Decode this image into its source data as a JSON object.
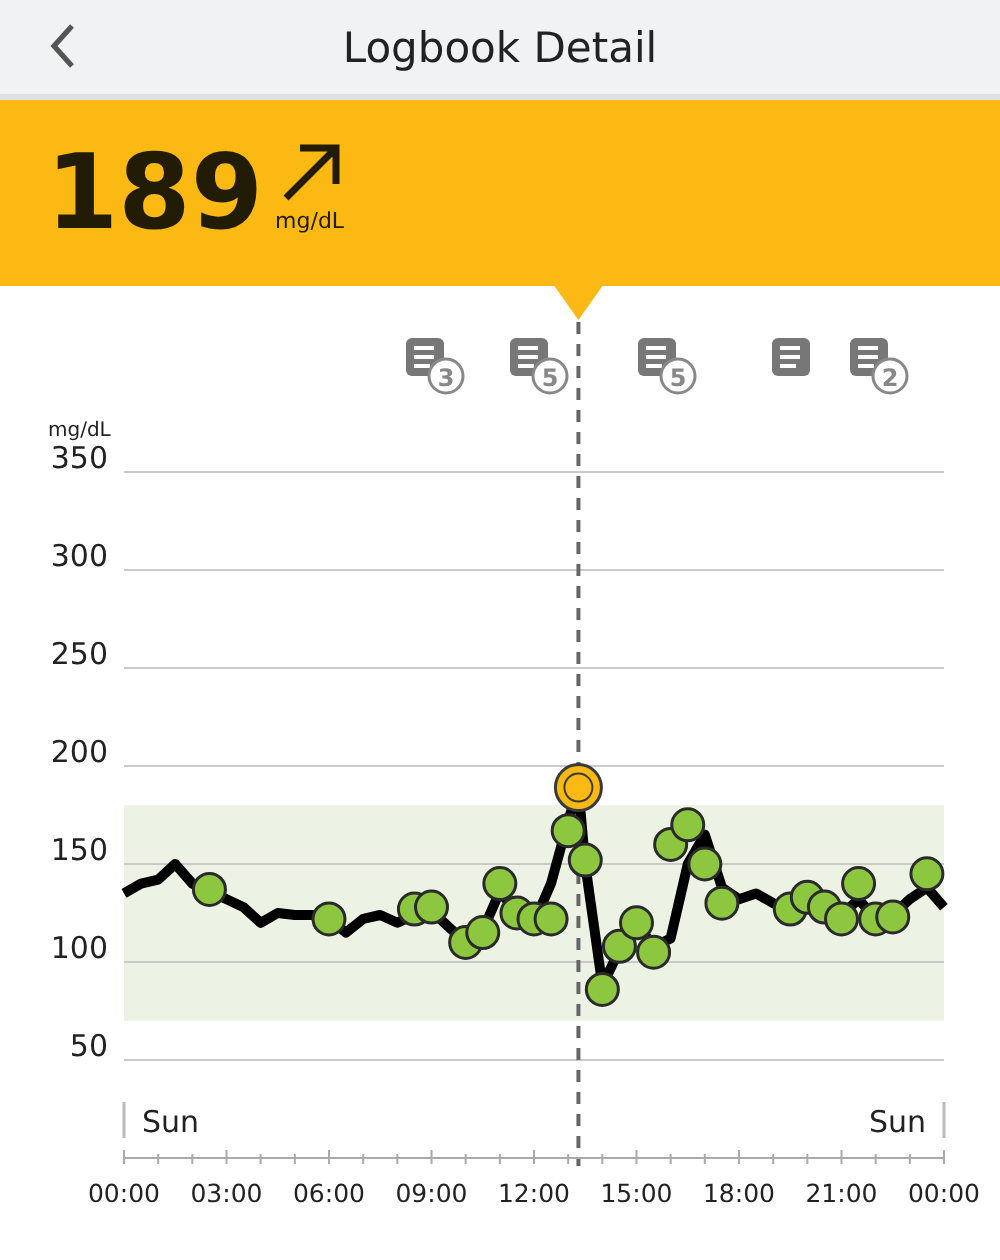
{
  "header": {
    "title": "Logbook Detail"
  },
  "reading": {
    "value": "189",
    "unit": "mg/dL"
  },
  "chart": {
    "day_labels": [
      "Sun",
      "Sun"
    ],
    "notes": [
      {
        "kind": "counted",
        "count": "3"
      },
      {
        "kind": "counted",
        "count": "5"
      },
      {
        "kind": "counted",
        "count": "5"
      },
      {
        "kind": "plain"
      },
      {
        "kind": "counted",
        "count": "2"
      }
    ],
    "chart_data": {
      "type": "line",
      "ylabel": "mg/dL",
      "grid": true,
      "x": [
        0,
        0.5,
        1,
        1.5,
        2,
        2.5,
        3,
        3.5,
        4,
        4.5,
        5,
        5.5,
        6,
        6.5,
        7,
        7.5,
        8,
        8.5,
        9,
        9.5,
        10,
        10.5,
        11,
        11.5,
        12,
        12.5,
        13,
        13.3,
        13.5,
        14,
        14.5,
        15,
        15.5,
        16,
        16.5,
        17,
        17.5,
        18,
        18.5,
        19,
        19.5,
        20,
        20.5,
        21,
        21.5,
        22,
        22.5,
        23,
        23.5,
        24
      ],
      "series": [
        {
          "color": "#000000",
          "values": [
            135,
            140,
            142,
            150,
            140,
            136,
            132,
            128,
            120,
            125,
            124,
            124,
            122,
            115,
            122,
            124,
            120,
            124,
            126,
            118,
            110,
            116,
            136,
            125,
            120,
            140,
            172,
            189,
            150,
            88,
            106,
            120,
            108,
            112,
            150,
            165,
            138,
            132,
            135,
            130,
            127,
            133,
            128,
            124,
            132,
            122,
            124,
            132,
            138,
            128
          ]
        },
        {
          "type": "scatter",
          "color": "#8dc63f",
          "values": [
            null,
            null,
            null,
            null,
            null,
            137,
            null,
            null,
            null,
            null,
            null,
            null,
            122,
            null,
            null,
            null,
            null,
            127,
            128,
            null,
            110,
            115,
            140,
            125,
            122,
            122,
            167,
            null,
            152,
            86,
            108,
            120,
            105,
            160,
            170,
            150,
            130,
            null,
            null,
            null,
            127,
            133,
            128,
            122,
            140,
            122,
            123,
            null,
            145,
            null
          ]
        },
        {
          "type": "scatter",
          "color": "#fdb913",
          "values": [
            null,
            null,
            null,
            null,
            null,
            null,
            null,
            null,
            null,
            null,
            null,
            null,
            null,
            null,
            null,
            null,
            null,
            null,
            null,
            null,
            null,
            null,
            null,
            null,
            null,
            null,
            null,
            189,
            null,
            null,
            null,
            null,
            null,
            null,
            null,
            null,
            null,
            null,
            null,
            null,
            null,
            null,
            null,
            null,
            null,
            null,
            null,
            null,
            null,
            null
          ]
        }
      ],
      "ref_lines": [
        {
          "axis": "x",
          "value": 13.3,
          "color": "#666666"
        }
      ],
      "bands": [
        {
          "axis": "y",
          "from": 70,
          "to": 180,
          "color": "#edf3e4"
        }
      ],
      "ylim": [
        50,
        350
      ],
      "yticks": [
        50,
        100,
        150,
        200,
        250,
        300,
        350
      ],
      "xlim": [
        0,
        24
      ],
      "xticks": [
        {
          "value": 0,
          "label": "00:00"
        },
        {
          "value": 3,
          "label": "03:00"
        },
        {
          "value": 6,
          "label": "06:00"
        },
        {
          "value": 9,
          "label": "09:00"
        },
        {
          "value": 12,
          "label": "12:00"
        },
        {
          "value": 15,
          "label": "15:00"
        },
        {
          "value": 18,
          "label": "18:00"
        },
        {
          "value": 21,
          "label": "21:00"
        },
        {
          "value": 24,
          "label": "00:00"
        }
      ]
    }
  }
}
